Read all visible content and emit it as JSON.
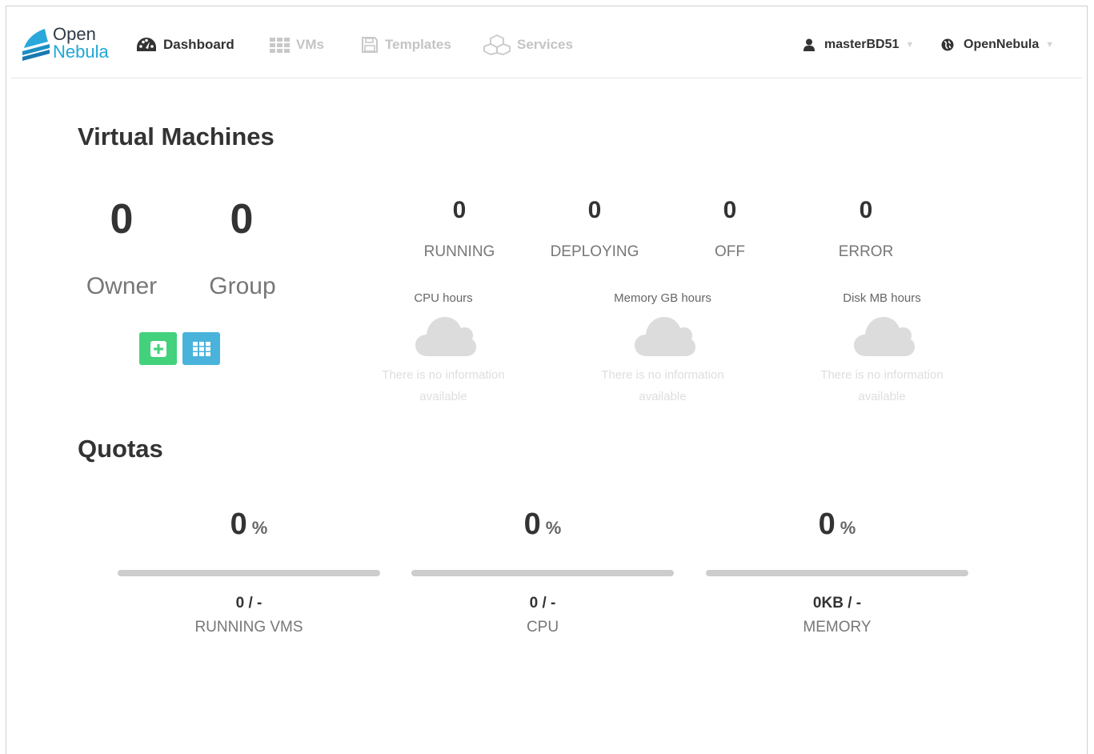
{
  "app": {
    "logo_open": "Open",
    "logo_nebula": "Nebula"
  },
  "nav": {
    "dashboard": "Dashboard",
    "vms": "VMs",
    "templates": "Templates",
    "services": "Services",
    "user": "masterBD51",
    "zone": "OpenNebula"
  },
  "vms_section": {
    "title": "Virtual Machines",
    "owner_count": "0",
    "owner_label": "Owner",
    "group_count": "0",
    "group_label": "Group",
    "states": [
      {
        "value": "0",
        "label": "RUNNING"
      },
      {
        "value": "0",
        "label": "DEPLOYING"
      },
      {
        "value": "0",
        "label": "OFF"
      },
      {
        "value": "0",
        "label": "ERROR"
      }
    ],
    "usage": [
      {
        "title": "CPU hours",
        "empty_line1": "There is no information",
        "empty_line2": "available"
      },
      {
        "title": "Memory GB hours",
        "empty_line1": "There is no information",
        "empty_line2": "available"
      },
      {
        "title": "Disk MB hours",
        "empty_line1": "There is no information",
        "empty_line2": "available"
      }
    ]
  },
  "quotas": {
    "title": "Quotas",
    "items": [
      {
        "percent": "0",
        "percent_sign": "%",
        "fraction": 0,
        "used": "0 / -",
        "name": "RUNNING VMS"
      },
      {
        "percent": "0",
        "percent_sign": "%",
        "fraction": 0,
        "used": "0 / -",
        "name": "CPU"
      },
      {
        "percent": "0",
        "percent_sign": "%",
        "fraction": 0,
        "used": "0KB / -",
        "name": "MEMORY"
      }
    ]
  },
  "colors": {
    "accent": "#1fa7d8",
    "create_button": "#43d17c",
    "list_button": "#4ab3db",
    "bar_track": "#cdcdcd"
  },
  "icons": {
    "dashboard": "tachometer-icon",
    "vms": "grid-icon",
    "templates": "floppy-disk-icon",
    "services": "cubes-icon",
    "user": "user-icon",
    "zone": "globe-icon",
    "create": "plus-square-icon",
    "list": "th-grid-icon",
    "empty_chart": "cloud-icon"
  }
}
